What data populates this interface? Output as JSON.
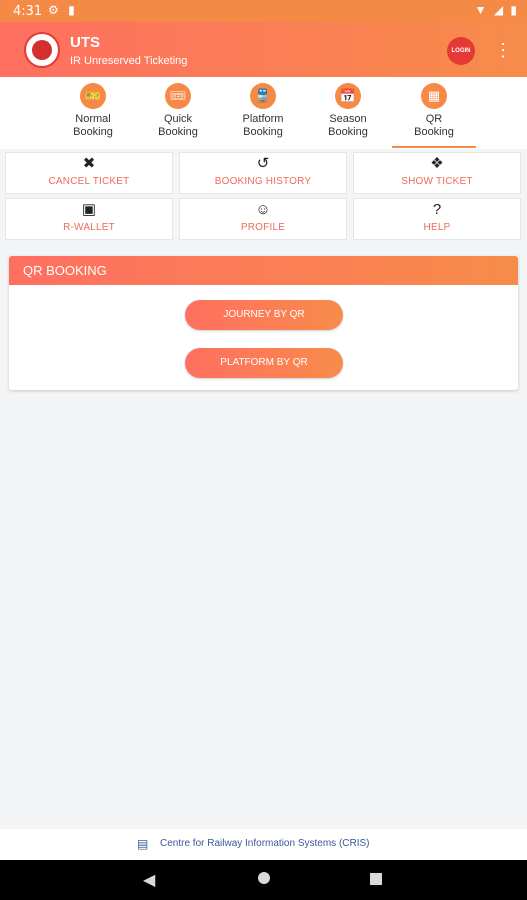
{
  "status_bar": {
    "time": "4:31",
    "left_icons": [
      "⚙",
      "▮"
    ],
    "right_icons": [
      "▼",
      "◢",
      "▮"
    ]
  },
  "header": {
    "title": "UTS",
    "subtitle": "IR Unreserved Ticketing",
    "login_label": "LOGIN",
    "more_icon": "⋮"
  },
  "tabs": [
    {
      "label": "Normal\nBooking",
      "icon": "🎫"
    },
    {
      "label": "Quick\nBooking",
      "icon": "🎟"
    },
    {
      "label": "Platform\nBooking",
      "icon": "🚆"
    },
    {
      "label": "Season\nBooking",
      "icon": "📅"
    },
    {
      "label": "QR\nBooking",
      "icon": "▦"
    }
  ],
  "actions": [
    {
      "label": "CANCEL TICKET",
      "icon": "✖"
    },
    {
      "label": "BOOKING HISTORY",
      "icon": "↺"
    },
    {
      "label": "SHOW TICKET",
      "icon": "❖"
    },
    {
      "label": "R-WALLET",
      "icon": "▣"
    },
    {
      "label": "PROFILE",
      "icon": "☺"
    },
    {
      "label": "HELP",
      "icon": "?"
    }
  ],
  "qr_booking": {
    "title": "QR BOOKING",
    "buttons": [
      "JOURNEY BY QR",
      "PLATFORM BY QR"
    ]
  },
  "footer": {
    "icon": "▤",
    "text": "Centre for Railway Information Systems (CRIS)"
  },
  "nav": {
    "back": "◀"
  }
}
